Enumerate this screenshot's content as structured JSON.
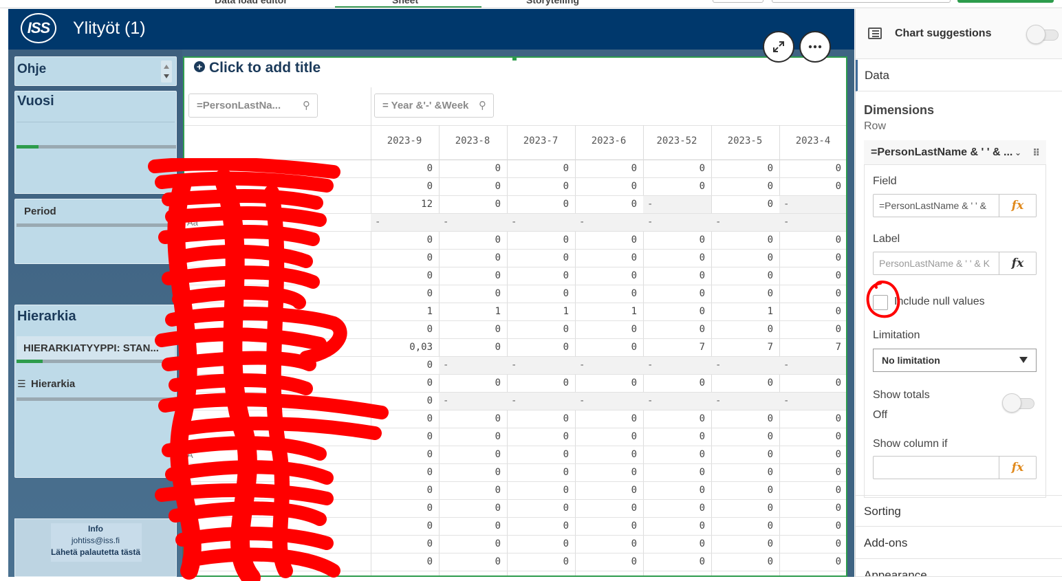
{
  "topbar": {
    "tabs": [
      "Data load editor",
      "Sheet",
      "Storytelling"
    ]
  },
  "app": {
    "logo": "ISS",
    "title": "Ylityöt (1)"
  },
  "filters": {
    "ohje": "Ohje",
    "vuosi": "Vuosi",
    "period": "Period",
    "hierarkia_title": "Hierarkia",
    "hierarkiatyyppi": "HIERARKIATYYPPI: STAN...",
    "hierarkia_list": "Hierarkia"
  },
  "info": {
    "title": "Info",
    "email": "johtiss@iss.fi",
    "feedback": "Lähetä palautetta tästä"
  },
  "table": {
    "title": "Click to add title",
    "row_search": "=PersonLastNa...",
    "col_search": "= Year &'-' &Week",
    "columns": [
      "2023-9",
      "2023-8",
      "2023-7",
      "2023-6",
      "2023-52",
      "2023-5",
      "2023-4"
    ],
    "row_labels": [
      "",
      "",
      "",
      "Aa",
      "",
      "",
      "",
      "",
      "",
      "",
      "",
      "",
      "",
      "",
      "",
      "",
      "A",
      "",
      "",
      "",
      "A",
      "",
      ""
    ],
    "rows": [
      [
        "0",
        "0",
        "0",
        "0",
        "0",
        "0",
        "0"
      ],
      [
        "0",
        "0",
        "0",
        "0",
        "0",
        "0",
        "0"
      ],
      [
        "12",
        "0",
        "0",
        "0",
        "-",
        "0",
        "-"
      ],
      [
        "-",
        "-",
        "-",
        "-",
        "-",
        "-",
        "-"
      ],
      [
        "0",
        "0",
        "0",
        "0",
        "0",
        "0",
        "0"
      ],
      [
        "0",
        "0",
        "0",
        "0",
        "0",
        "0",
        "0"
      ],
      [
        "0",
        "0",
        "0",
        "0",
        "0",
        "0",
        "0"
      ],
      [
        "0",
        "0",
        "0",
        "0",
        "0",
        "0",
        "0"
      ],
      [
        "1",
        "1",
        "1",
        "1",
        "0",
        "1",
        "0"
      ],
      [
        "0",
        "0",
        "0",
        "0",
        "0",
        "0",
        "0"
      ],
      [
        "0,03",
        "0",
        "0",
        "0",
        "7",
        "7",
        "7"
      ],
      [
        "0",
        "-",
        "-",
        "-",
        "-",
        "-",
        "-"
      ],
      [
        "0",
        "0",
        "0",
        "0",
        "0",
        "0",
        "0"
      ],
      [
        "0",
        "-",
        "-",
        "-",
        "-",
        "-",
        "-"
      ],
      [
        "0",
        "0",
        "0",
        "0",
        "0",
        "0",
        "0"
      ],
      [
        "0",
        "0",
        "0",
        "0",
        "0",
        "0",
        "0"
      ],
      [
        "0",
        "0",
        "0",
        "0",
        "0",
        "0",
        "0"
      ],
      [
        "0",
        "0",
        "0",
        "0",
        "0",
        "0",
        "0"
      ],
      [
        "0",
        "0",
        "0",
        "0",
        "0",
        "0",
        "0"
      ],
      [
        "0",
        "0",
        "0",
        "0",
        "0",
        "0",
        "0"
      ],
      [
        "0",
        "0",
        "0",
        "0",
        "0",
        "0",
        "0"
      ],
      [
        "0",
        "0",
        "0",
        "0",
        "0",
        "0",
        "0"
      ],
      [
        "0",
        "0",
        "0",
        "0",
        "0",
        "0",
        "0"
      ]
    ]
  },
  "panel": {
    "chart_suggestions": "Chart suggestions",
    "data_tab": "Data",
    "dimensions": "Dimensions",
    "row": "Row",
    "dimension_name": "=PersonLastName & ' ' & ...",
    "field_label": "Field",
    "field_value": "=PersonLastName & ' ' &",
    "label_label": "Label",
    "label_placeholder": "PersonLastName & ' ' & K",
    "include_null": "Include null values",
    "limitation_label": "Limitation",
    "limitation_value": "No limitation",
    "show_totals": "Show totals",
    "show_totals_value": "Off",
    "show_column_if": "Show column if",
    "fx": "fx",
    "sorting": "Sorting",
    "addons": "Add-ons",
    "appearance": "Appearance"
  },
  "colors": {
    "header": "#00386c",
    "accent": "#2d9c4c",
    "fx_orange": "#e08a1e",
    "annotation_red": "#ff0000"
  }
}
